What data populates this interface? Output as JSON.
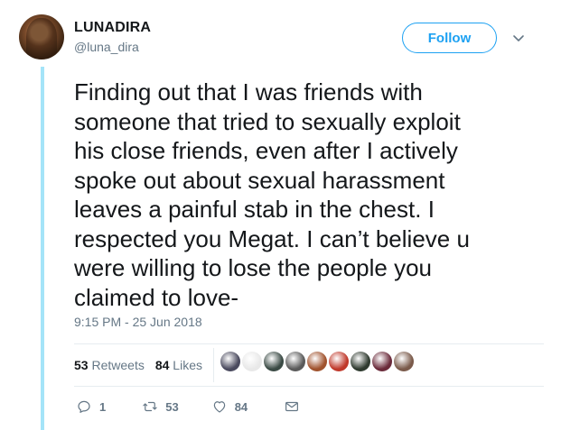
{
  "user": {
    "display_name": "LUNADIRA",
    "handle": "@luna_dira"
  },
  "follow_label": "Follow",
  "tweet_text": "Finding out that I was friends with\nsomeone that tried to sexually exploit\nhis close friends, even after I actively\nspoke out about sexual harassment\nleaves a painful stab in the chest. I\nrespected you Megat. I can’t believe u\nwere willing to lose the people you\nclaimed to love-",
  "timestamp": "9:15 PM - 25 Jun 2018",
  "stats": {
    "retweets_count": "53",
    "retweets_label": "Retweets",
    "likes_count": "84",
    "likes_label": "Likes"
  },
  "liker_avatar_colors": [
    "#4a4a5e",
    "#e8e8e8",
    "#3a4a44",
    "#5a5a5a",
    "#a0522d",
    "#c0392b",
    "#2f3a2f",
    "#6a2a3a",
    "#7a5a4a"
  ],
  "actions": {
    "reply_count": "1",
    "retweet_count": "53",
    "like_count": "84"
  },
  "colors": {
    "accent": "#1da1f2",
    "secondary": "#657786",
    "thread_line": "#a4e4f8"
  }
}
